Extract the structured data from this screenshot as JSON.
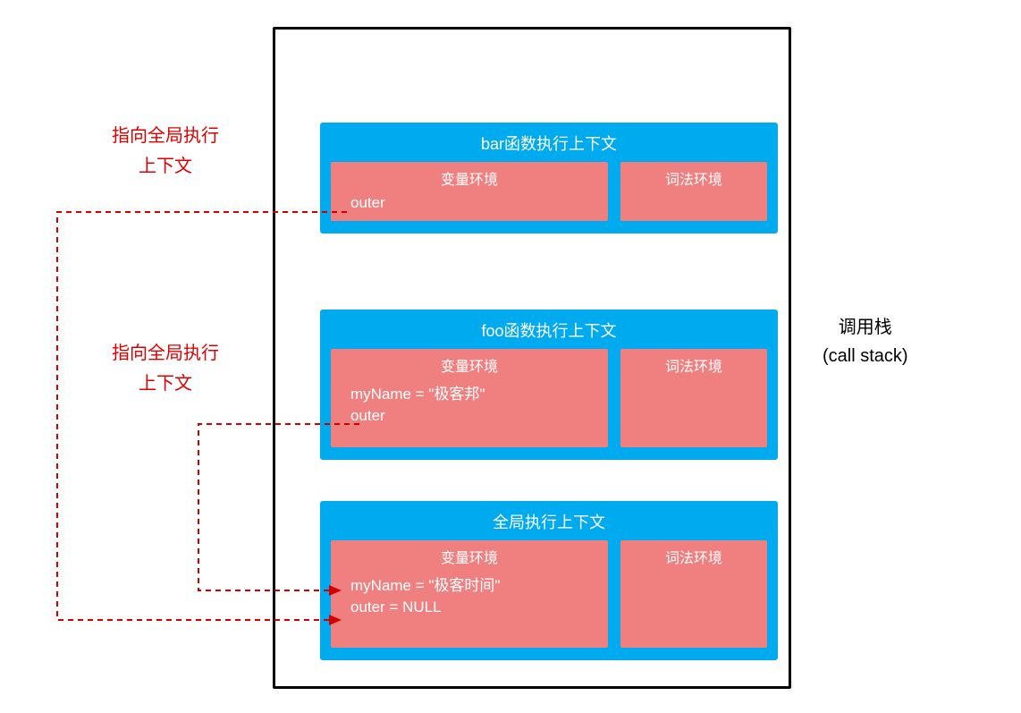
{
  "sideLabel": {
    "line1": "调用栈",
    "line2": "(call stack)"
  },
  "annotations": {
    "top": {
      "line1": "指向全局执行",
      "line2": "上下文"
    },
    "mid": {
      "line1": "指向全局执行",
      "line2": "上下文"
    }
  },
  "contexts": {
    "bar": {
      "title": "bar函数执行上下文",
      "varEnvLabel": "变量环境",
      "lexEnvLabel": "词法环境",
      "lines": [
        "outer"
      ]
    },
    "foo": {
      "title": "foo函数执行上下文",
      "varEnvLabel": "变量环境",
      "lexEnvLabel": "词法环境",
      "lines": [
        "myName = \"极客邦\"",
        "outer"
      ]
    },
    "global": {
      "title": "全局执行上下文",
      "varEnvLabel": "变量环境",
      "lexEnvLabel": "词法环境",
      "lines": [
        "myName = \"极客时间\"",
        "outer = NULL"
      ]
    }
  },
  "colors": {
    "context": "#00aaee",
    "env": "#f08080",
    "arrow": "#d00000"
  }
}
